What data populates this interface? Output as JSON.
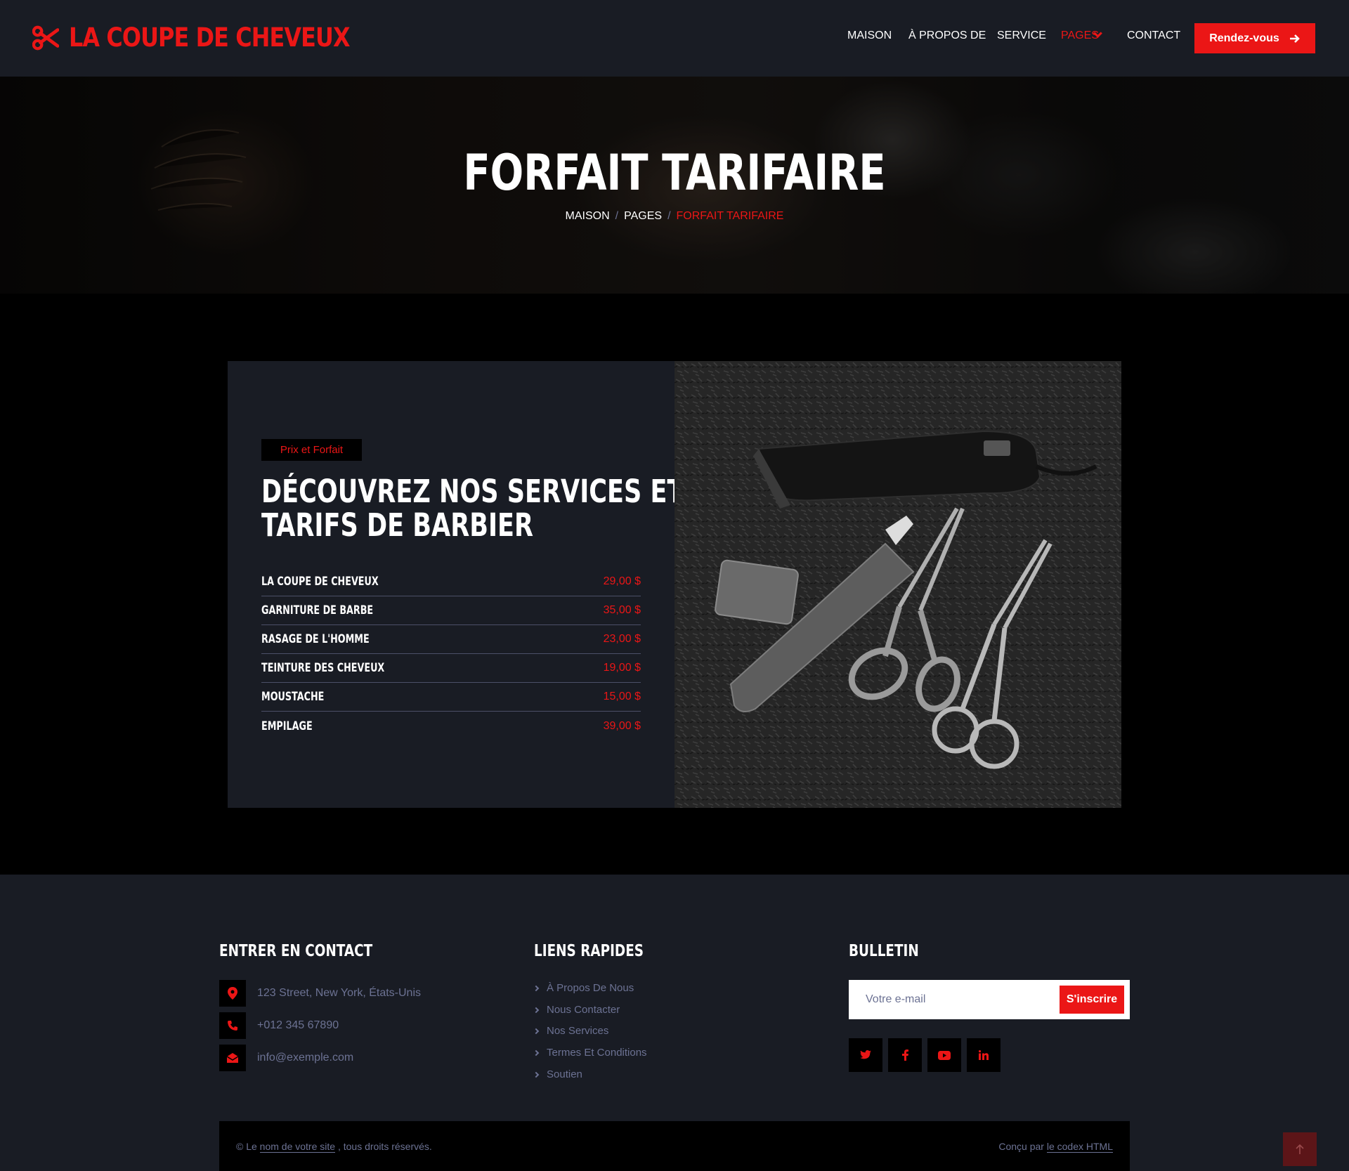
{
  "navbar": {
    "brand": "LA COUPE DE CHEVEUX",
    "items": [
      {
        "label": "MAISON"
      },
      {
        "label": "À PROPOS DE"
      },
      {
        "label": "SERVICE"
      },
      {
        "label": "PAGES"
      },
      {
        "label": "CONTACT"
      }
    ],
    "cta_label": "Rendez-vous",
    "accent": "#eb1616"
  },
  "hero": {
    "title": "FORFAIT TARIFAIRE",
    "breadcrumb": [
      "MAISON",
      "PAGES",
      "FORFAIT TARIFAIRE"
    ]
  },
  "pricing": {
    "tag": "Prix et Forfait",
    "heading_line1": "DÉCOUVREZ NOS SERVICES ET",
    "heading_line2": "TARIFS DE BARBIER",
    "items": [
      {
        "name": "LA COUPE DE CHEVEUX",
        "price": "29,00 $"
      },
      {
        "name": "GARNITURE DE BARBE",
        "price": "35,00 $"
      },
      {
        "name": "RASAGE DE L'HOMME",
        "price": "23,00 $"
      },
      {
        "name": "TEINTURE DES CHEVEUX",
        "price": "19,00 $"
      },
      {
        "name": "MOUSTACHE",
        "price": "15,00 $"
      },
      {
        "name": "EMPILAGE",
        "price": "39,00 $"
      }
    ]
  },
  "footer": {
    "contact_title": "ENTRER EN CONTACT",
    "address": "123 Street, New York, États-Unis",
    "phone": "+012 345 67890",
    "email": "info@exemple.com",
    "links_title": "LIENS RAPIDES",
    "links": [
      "À Propos De Nous",
      "Nous Contacter",
      "Nos Services",
      "Termes Et Conditions",
      "Soutien"
    ],
    "newsletter_title": "BULLETIN",
    "email_placeholder": "Votre e-mail",
    "subscribe_label": "S'inscrire",
    "copyright_prefix": "© Le ",
    "copyright_link": "nom de votre site",
    "copyright_suffix": " , tous droits réservés.",
    "designed_prefix": "Conçu par ",
    "designed_link": "le codex HTML"
  }
}
